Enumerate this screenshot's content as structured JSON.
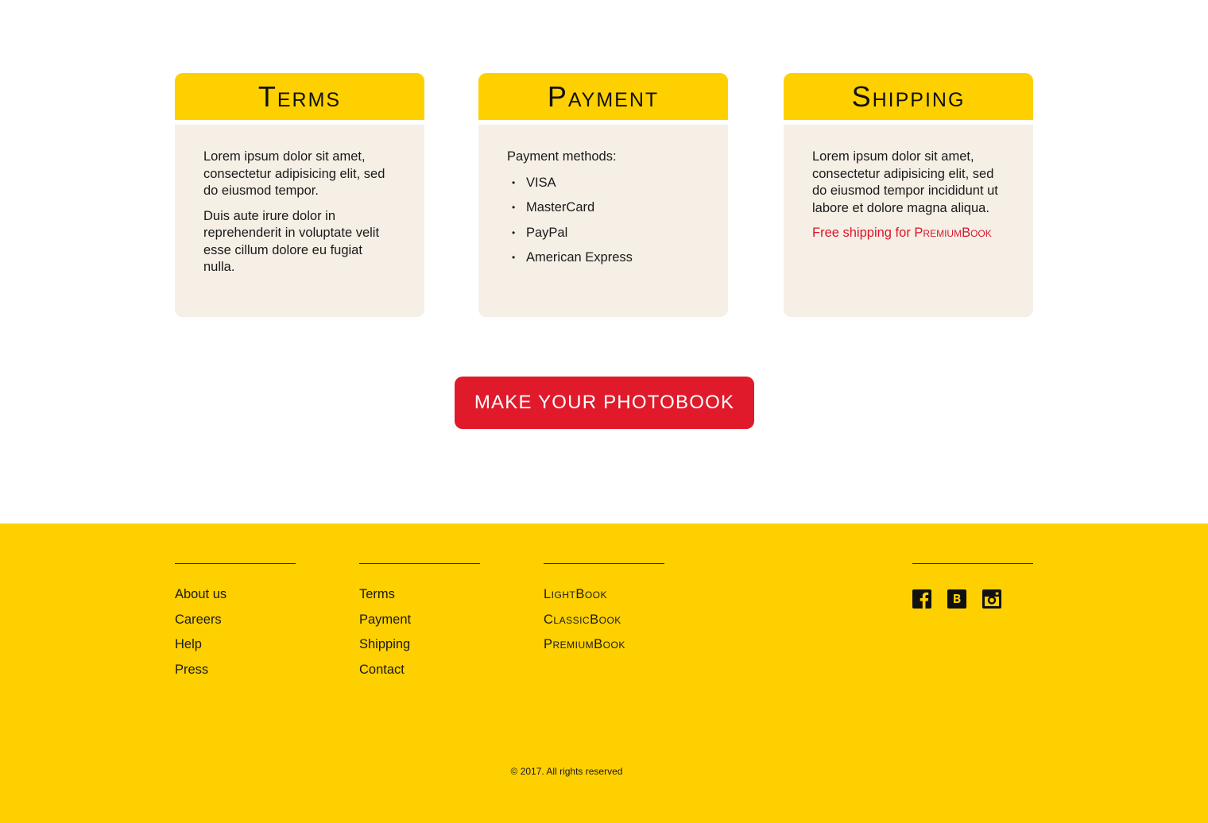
{
  "cards": [
    {
      "title": "Terms",
      "paragraphs": [
        "Lorem ipsum dolor sit amet, consectetur adipisicing elit, sed do eiusmod tempor.",
        "Duis aute irure dolor in reprehenderit in voluptate velit esse cillum dolore eu fugiat nulla."
      ]
    },
    {
      "title": "Payment",
      "intro": "Payment methods:",
      "methods": [
        "VISA",
        "MasterCard",
        "PayPal",
        "American Express"
      ]
    },
    {
      "title": "Shipping",
      "paragraph": "Lorem ipsum dolor sit amet, consectetur adipisicing elit, sed do eiusmod tempor incididunt ut labore et dolore magna aliqua.",
      "free_shipping_prefix": "Free shipping for",
      "free_shipping_product": "PremiumBook"
    }
  ],
  "cta": {
    "label": "MAKE YOUR PHOTOBOOK"
  },
  "footer": {
    "company_links": [
      "About us",
      "Careers",
      "Help",
      "Press"
    ],
    "info_links": [
      "Terms",
      "Payment",
      "Shipping",
      "Contact"
    ],
    "product_links": [
      "LightBook",
      "ClassicBook",
      "PremiumBook"
    ],
    "social_icons": [
      "facebook-icon",
      "behance-icon",
      "instagram-icon"
    ],
    "copyright": "© 2017. All rights reserved"
  },
  "colors": {
    "accent_yellow": "#fed000",
    "cta_red": "#e01a2b",
    "card_body": "#f5efe6",
    "highlight_red": "#d8172a"
  }
}
